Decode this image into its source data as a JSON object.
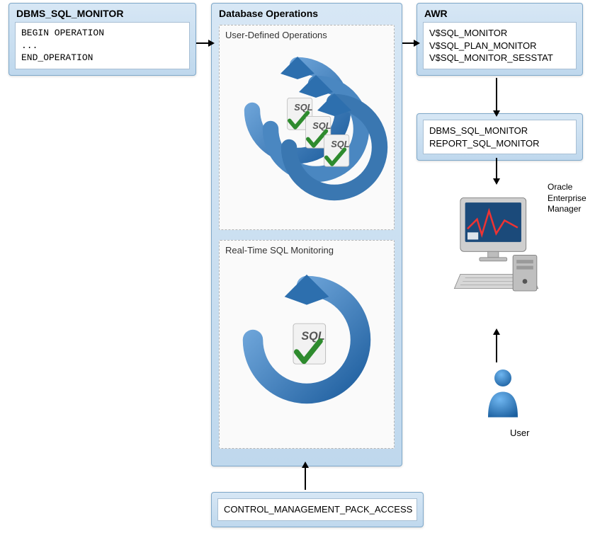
{
  "dbms": {
    "title": "DBMS_SQL_MONITOR",
    "code": "BEGIN OPERATION\n...\nEND_OPERATION"
  },
  "dbops": {
    "title": "Database Operations",
    "user_defined": {
      "title": "User-Defined Operations"
    },
    "realtime": {
      "title": "Real-Time SQL Monitoring"
    }
  },
  "awr": {
    "title": "AWR",
    "views": "V$SQL_MONITOR\nV$SQL_PLAN_MONITOR\nV$SQL_MONITOR_SESSTAT"
  },
  "report": {
    "text": "DBMS_SQL_MONITOR\nREPORT_SQL_MONITOR"
  },
  "oem": {
    "label": "Oracle\nEnterprise\nManager"
  },
  "user": {
    "label": "User"
  },
  "cmpa": {
    "text": "CONTROL_MANAGEMENT_PACK_ACCESS"
  }
}
